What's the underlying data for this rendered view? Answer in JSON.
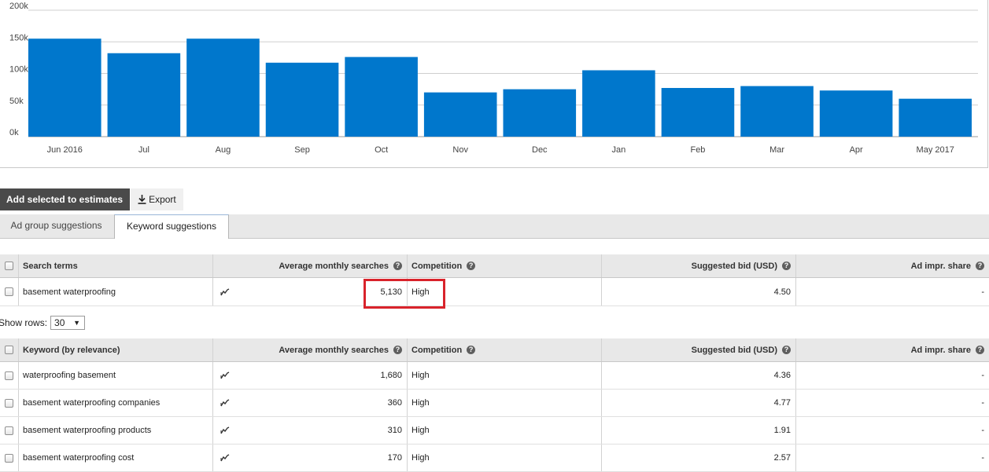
{
  "chart_data": {
    "type": "bar",
    "categories": [
      "Jun 2016",
      "Jul",
      "Aug",
      "Sep",
      "Oct",
      "Nov",
      "Dec",
      "Jan",
      "Feb",
      "Mar",
      "Apr",
      "May 2017"
    ],
    "values": [
      155000,
      132000,
      155000,
      117000,
      126000,
      70000,
      75000,
      105000,
      77000,
      80000,
      73000,
      60000
    ],
    "y_ticks": [
      "0k",
      "50k",
      "100k",
      "150k",
      "200k"
    ],
    "ylim": [
      0,
      200000
    ],
    "grid": true,
    "bar_color": "#0077cc"
  },
  "toolbar": {
    "add_label": "Add selected to estimates",
    "export_label": "Export"
  },
  "tabs": [
    {
      "label": "Ad group suggestions",
      "active": false
    },
    {
      "label": "Keyword suggestions",
      "active": true
    }
  ],
  "search_table": {
    "headers": {
      "term": "Search terms",
      "avg": "Average monthly searches",
      "competition": "Competition",
      "bid": "Suggested bid (USD)",
      "share": "Ad impr. share"
    },
    "rows": [
      {
        "term": "basement waterproofing",
        "avg": "5,130",
        "competition": "High",
        "bid": "4.50",
        "share": "-"
      }
    ]
  },
  "show_rows": {
    "label": "Show rows:",
    "value": "30"
  },
  "keyword_table": {
    "headers": {
      "term": "Keyword (by relevance)",
      "avg": "Average monthly searches",
      "competition": "Competition",
      "bid": "Suggested bid (USD)",
      "share": "Ad impr. share"
    },
    "rows": [
      {
        "term": "waterproofing basement",
        "avg": "1,680",
        "competition": "High",
        "bid": "4.36",
        "share": "-"
      },
      {
        "term": "basement waterproofing companies",
        "avg": "360",
        "competition": "High",
        "bid": "4.77",
        "share": "-"
      },
      {
        "term": "basement waterproofing products",
        "avg": "310",
        "competition": "High",
        "bid": "1.91",
        "share": "-"
      },
      {
        "term": "basement waterproofing cost",
        "avg": "170",
        "competition": "High",
        "bid": "2.57",
        "share": "-"
      }
    ]
  },
  "colors": {
    "highlight": "#d9232b",
    "header_bg": "#e8e8e8",
    "dark_button": "#4a4a4a"
  },
  "icons": {
    "trend": "trend-chart-icon",
    "help": "help-icon",
    "export": "download-icon"
  }
}
